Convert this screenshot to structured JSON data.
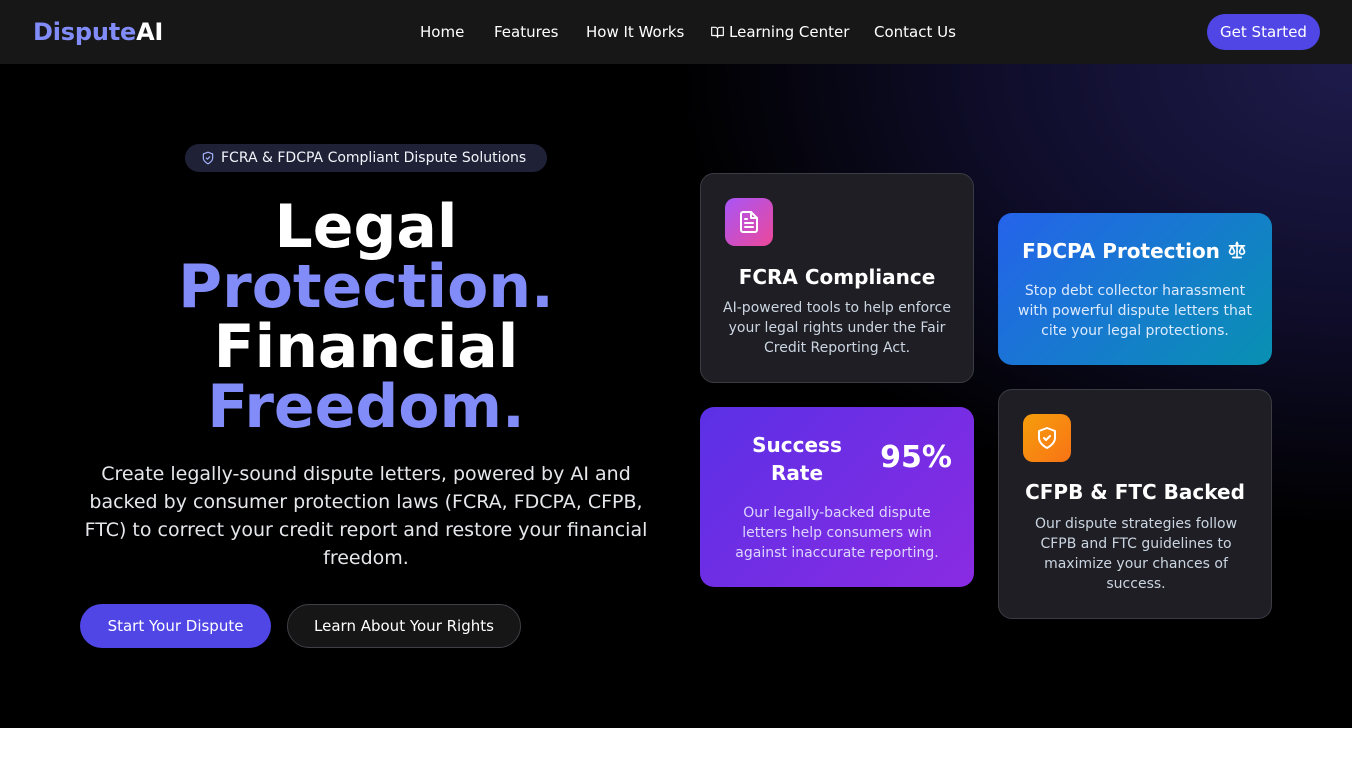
{
  "brand": {
    "name_part1": "Dispute",
    "name_part2": "AI"
  },
  "nav": {
    "items": [
      {
        "label": "Home"
      },
      {
        "label": "Features"
      },
      {
        "label": "How It Works"
      },
      {
        "label": "Learning Center",
        "icon": "book-icon"
      },
      {
        "label": "Contact Us"
      }
    ],
    "cta_label": "Get Started"
  },
  "hero": {
    "badge": {
      "icon": "shield-icon",
      "text": "FCRA & FDCPA Compliant Dispute Solutions"
    },
    "headline": {
      "line1": "Legal",
      "line2": "Protection.",
      "line3": "Financial",
      "line4": "Freedom."
    },
    "subtext": "Create legally-sound dispute letters, powered by AI and backed by consumer protection laws (FCRA, FDCPA, CFPB, FTC) to correct your credit report and restore your financial freedom.",
    "primary_button": "Start Your Dispute",
    "secondary_button": "Learn About Your Rights"
  },
  "cards": {
    "fcra": {
      "icon": "document-icon",
      "title": "FCRA Compliance",
      "description": "AI-powered tools to help enforce your legal rights under the Fair Credit Reporting Act."
    },
    "fdcpa": {
      "icon": "scale-icon",
      "title": "FDCPA Protection",
      "description": "Stop debt collector harassment with powerful dispute letters that cite your legal protections."
    },
    "success": {
      "label": "Success Rate",
      "value": "95%",
      "description": "Our legally-backed dispute letters help consumers win against inaccurate reporting."
    },
    "cfpb": {
      "icon": "shield-check-icon",
      "title": "CFPB & FTC Backed",
      "description": "Our dispute strategies follow CFPB and FTC guidelines to maximize your chances of success."
    }
  },
  "colors": {
    "accent": "#818cf8",
    "primary_button": "#4f46e5",
    "nav_background": "#171717"
  }
}
